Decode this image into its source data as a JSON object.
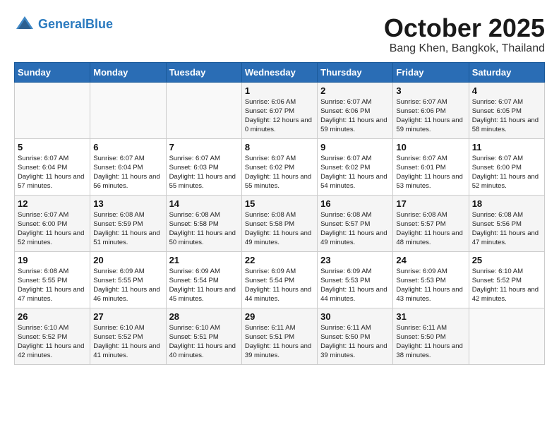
{
  "header": {
    "logo_line1": "General",
    "logo_line2": "Blue",
    "month_title": "October 2025",
    "location": "Bang Khen, Bangkok, Thailand"
  },
  "weekdays": [
    "Sunday",
    "Monday",
    "Tuesday",
    "Wednesday",
    "Thursday",
    "Friday",
    "Saturday"
  ],
  "weeks": [
    [
      {
        "day": "",
        "sunrise": "",
        "sunset": "",
        "daylight": ""
      },
      {
        "day": "",
        "sunrise": "",
        "sunset": "",
        "daylight": ""
      },
      {
        "day": "",
        "sunrise": "",
        "sunset": "",
        "daylight": ""
      },
      {
        "day": "1",
        "sunrise": "6:06 AM",
        "sunset": "6:07 PM",
        "daylight": "12 hours and 0 minutes."
      },
      {
        "day": "2",
        "sunrise": "6:07 AM",
        "sunset": "6:06 PM",
        "daylight": "11 hours and 59 minutes."
      },
      {
        "day": "3",
        "sunrise": "6:07 AM",
        "sunset": "6:06 PM",
        "daylight": "11 hours and 59 minutes."
      },
      {
        "day": "4",
        "sunrise": "6:07 AM",
        "sunset": "6:05 PM",
        "daylight": "11 hours and 58 minutes."
      }
    ],
    [
      {
        "day": "5",
        "sunrise": "6:07 AM",
        "sunset": "6:04 PM",
        "daylight": "11 hours and 57 minutes."
      },
      {
        "day": "6",
        "sunrise": "6:07 AM",
        "sunset": "6:04 PM",
        "daylight": "11 hours and 56 minutes."
      },
      {
        "day": "7",
        "sunrise": "6:07 AM",
        "sunset": "6:03 PM",
        "daylight": "11 hours and 55 minutes."
      },
      {
        "day": "8",
        "sunrise": "6:07 AM",
        "sunset": "6:02 PM",
        "daylight": "11 hours and 55 minutes."
      },
      {
        "day": "9",
        "sunrise": "6:07 AM",
        "sunset": "6:02 PM",
        "daylight": "11 hours and 54 minutes."
      },
      {
        "day": "10",
        "sunrise": "6:07 AM",
        "sunset": "6:01 PM",
        "daylight": "11 hours and 53 minutes."
      },
      {
        "day": "11",
        "sunrise": "6:07 AM",
        "sunset": "6:00 PM",
        "daylight": "11 hours and 52 minutes."
      }
    ],
    [
      {
        "day": "12",
        "sunrise": "6:07 AM",
        "sunset": "6:00 PM",
        "daylight": "11 hours and 52 minutes."
      },
      {
        "day": "13",
        "sunrise": "6:08 AM",
        "sunset": "5:59 PM",
        "daylight": "11 hours and 51 minutes."
      },
      {
        "day": "14",
        "sunrise": "6:08 AM",
        "sunset": "5:58 PM",
        "daylight": "11 hours and 50 minutes."
      },
      {
        "day": "15",
        "sunrise": "6:08 AM",
        "sunset": "5:58 PM",
        "daylight": "11 hours and 49 minutes."
      },
      {
        "day": "16",
        "sunrise": "6:08 AM",
        "sunset": "5:57 PM",
        "daylight": "11 hours and 49 minutes."
      },
      {
        "day": "17",
        "sunrise": "6:08 AM",
        "sunset": "5:57 PM",
        "daylight": "11 hours and 48 minutes."
      },
      {
        "day": "18",
        "sunrise": "6:08 AM",
        "sunset": "5:56 PM",
        "daylight": "11 hours and 47 minutes."
      }
    ],
    [
      {
        "day": "19",
        "sunrise": "6:08 AM",
        "sunset": "5:55 PM",
        "daylight": "11 hours and 47 minutes."
      },
      {
        "day": "20",
        "sunrise": "6:09 AM",
        "sunset": "5:55 PM",
        "daylight": "11 hours and 46 minutes."
      },
      {
        "day": "21",
        "sunrise": "6:09 AM",
        "sunset": "5:54 PM",
        "daylight": "11 hours and 45 minutes."
      },
      {
        "day": "22",
        "sunrise": "6:09 AM",
        "sunset": "5:54 PM",
        "daylight": "11 hours and 44 minutes."
      },
      {
        "day": "23",
        "sunrise": "6:09 AM",
        "sunset": "5:53 PM",
        "daylight": "11 hours and 44 minutes."
      },
      {
        "day": "24",
        "sunrise": "6:09 AM",
        "sunset": "5:53 PM",
        "daylight": "11 hours and 43 minutes."
      },
      {
        "day": "25",
        "sunrise": "6:10 AM",
        "sunset": "5:52 PM",
        "daylight": "11 hours and 42 minutes."
      }
    ],
    [
      {
        "day": "26",
        "sunrise": "6:10 AM",
        "sunset": "5:52 PM",
        "daylight": "11 hours and 42 minutes."
      },
      {
        "day": "27",
        "sunrise": "6:10 AM",
        "sunset": "5:52 PM",
        "daylight": "11 hours and 41 minutes."
      },
      {
        "day": "28",
        "sunrise": "6:10 AM",
        "sunset": "5:51 PM",
        "daylight": "11 hours and 40 minutes."
      },
      {
        "day": "29",
        "sunrise": "6:11 AM",
        "sunset": "5:51 PM",
        "daylight": "11 hours and 39 minutes."
      },
      {
        "day": "30",
        "sunrise": "6:11 AM",
        "sunset": "5:50 PM",
        "daylight": "11 hours and 39 minutes."
      },
      {
        "day": "31",
        "sunrise": "6:11 AM",
        "sunset": "5:50 PM",
        "daylight": "11 hours and 38 minutes."
      },
      {
        "day": "",
        "sunrise": "",
        "sunset": "",
        "daylight": ""
      }
    ]
  ]
}
